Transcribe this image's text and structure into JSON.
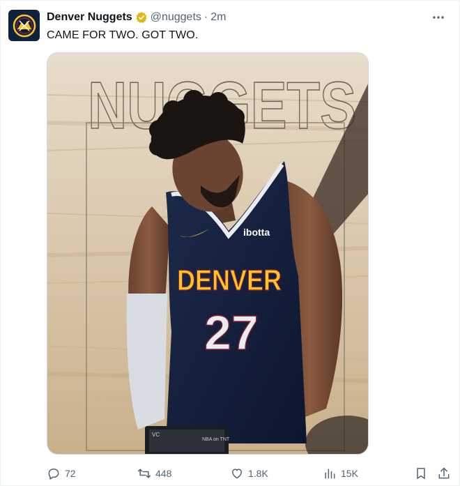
{
  "author": {
    "name": "Denver Nuggets",
    "handle": "@nuggets",
    "separator": "·",
    "time": "2m",
    "verified_badge": "gold-verified-icon"
  },
  "tweet": {
    "text": "CAME FOR TWO. GOT TWO."
  },
  "media": {
    "background_word": "NUGGETS",
    "jersey_city": "DENVER",
    "jersey_number": "27",
    "jersey_sponsor": "ibotta",
    "laptop_label_left": "VC",
    "laptop_label_right": "NBA on TNT"
  },
  "actions": {
    "replies": "72",
    "retweets": "448",
    "likes": "1.8K",
    "views": "15K"
  },
  "colors": {
    "nuggets_navy": "#0e2240",
    "nuggets_gold": "#fec524",
    "text_secondary": "#536471"
  }
}
